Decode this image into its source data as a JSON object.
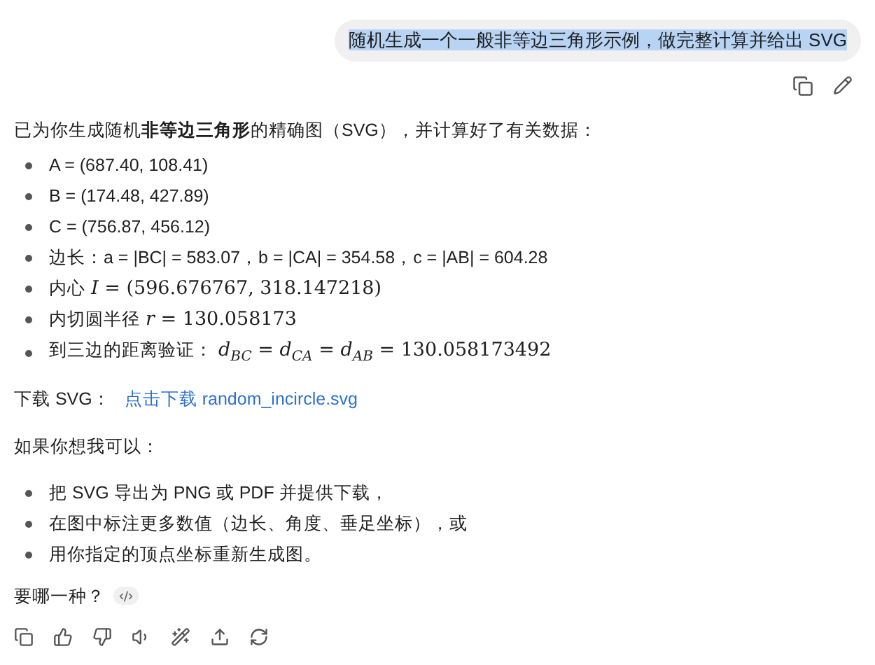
{
  "user_message": {
    "text": "随机生成一个一般非等边三角形示例，做完整计算并给出 SVG",
    "selected": true
  },
  "answer": {
    "intro": "已为你生成随机**非等边三角形**的精确图（SVG），并计算好了有关数据：",
    "facts": [
      {
        "kind": "text",
        "text": "A = (687.40, 108.41)"
      },
      {
        "kind": "text",
        "text": "B = (174.48, 427.89)"
      },
      {
        "kind": "text",
        "text": "C = (756.87, 456.12)"
      },
      {
        "kind": "text",
        "text": "边长：a = |BC| = 583.07，b = |CA| = 354.58，c = |AB| = 604.28"
      },
      {
        "kind": "math",
        "label": "内心",
        "math": "*I* = (596.676767, 318.147218)"
      },
      {
        "kind": "math",
        "label": "内切圆半径",
        "math": "*r* = 130.058173"
      },
      {
        "kind": "math",
        "label": "到三边的距离验证：",
        "math": "*d*$_{BC}$ = *d*$_{CA}$ = *d*$_{AB}$ = 130.058173492"
      }
    ],
    "download": {
      "label": "下载 SVG：",
      "link": "点击下载 random_incircle.svg"
    },
    "offer": "如果你想我可以：",
    "options": [
      "把 SVG 导出为 PNG 或 PDF 并提供下载，",
      "在图中标注更多数值（边长、角度、垂足坐标），或",
      "用你指定的顶点坐标重新生成图。"
    ],
    "question": "要哪一种？"
  }
}
